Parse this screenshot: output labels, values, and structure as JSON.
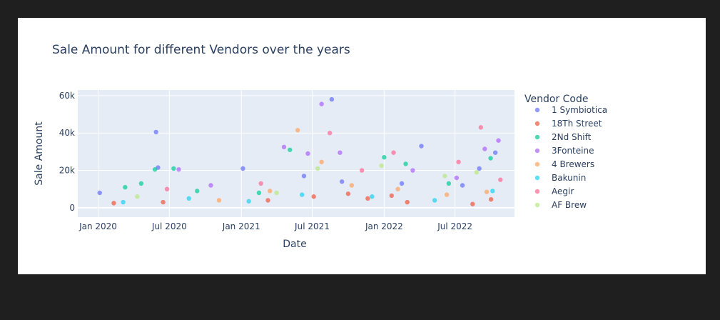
{
  "chart_data": {
    "type": "scatter",
    "title": "Sale Amount for different Vendors over the years",
    "xlabel": "Date",
    "ylabel": "Sale Amount",
    "x_ticks": [
      "Jan 2020",
      "Jul 2020",
      "Jan 2021",
      "Jul 2021",
      "Jan 2022",
      "Jul 2022"
    ],
    "x_tick_dates": [
      "2020-01-01",
      "2020-07-01",
      "2021-01-01",
      "2021-07-01",
      "2022-01-01",
      "2022-07-01"
    ],
    "y_ticks": [
      "0",
      "20k",
      "40k",
      "60k"
    ],
    "y_tick_values": [
      0,
      20000,
      40000,
      60000
    ],
    "xlim": [
      "2019-11-10",
      "2022-11-30"
    ],
    "ylim": [
      -5000,
      63000
    ],
    "grid": true,
    "legend_title": "Vendor Code",
    "legend_position": "right",
    "series": [
      {
        "name": "1 Symbiotica",
        "color": "#636efa",
        "points": [
          [
            "2020-05-28",
            40500
          ],
          [
            "2021-08-20",
            58000
          ],
          [
            "2020-06-02",
            21500
          ],
          [
            "2021-01-05",
            21000
          ],
          [
            "2022-04-06",
            33000
          ],
          [
            "2022-09-01",
            21000
          ],
          [
            "2022-10-12",
            29500
          ],
          [
            "2020-01-05",
            8000
          ],
          [
            "2021-06-10",
            17000
          ],
          [
            "2022-02-15",
            13000
          ],
          [
            "2021-09-15",
            14000
          ],
          [
            "2022-07-20",
            12000
          ]
        ]
      },
      {
        "name": "18Th Street",
        "color": "#EF553B",
        "points": [
          [
            "2020-02-10",
            2500
          ],
          [
            "2020-06-15",
            3000
          ],
          [
            "2021-03-10",
            4000
          ],
          [
            "2021-07-05",
            6000
          ],
          [
            "2021-11-20",
            5000
          ],
          [
            "2022-03-01",
            3000
          ],
          [
            "2022-08-15",
            2000
          ],
          [
            "2022-10-01",
            4500
          ],
          [
            "2021-10-01",
            7500
          ],
          [
            "2022-01-20",
            6500
          ]
        ]
      },
      {
        "name": "2Nd Shift",
        "color": "#00cc96",
        "points": [
          [
            "2020-05-25",
            20500
          ],
          [
            "2020-07-12",
            21000
          ],
          [
            "2020-04-20",
            13000
          ],
          [
            "2021-05-05",
            31000
          ],
          [
            "2022-01-01",
            27000
          ],
          [
            "2022-02-25",
            23500
          ],
          [
            "2022-09-30",
            26500
          ],
          [
            "2020-03-10",
            11000
          ],
          [
            "2020-09-10",
            9000
          ],
          [
            "2021-02-15",
            8000
          ],
          [
            "2022-06-15",
            13000
          ]
        ]
      },
      {
        "name": "3Fonteine",
        "color": "#ab63fa",
        "points": [
          [
            "2021-07-25",
            55500
          ],
          [
            "2021-04-20",
            32500
          ],
          [
            "2022-09-15",
            31500
          ],
          [
            "2020-07-25",
            20500
          ],
          [
            "2021-06-20",
            29000
          ],
          [
            "2022-03-15",
            20000
          ],
          [
            "2022-10-20",
            36000
          ],
          [
            "2021-09-10",
            29500
          ],
          [
            "2020-10-15",
            12000
          ],
          [
            "2022-07-05",
            16000
          ]
        ]
      },
      {
        "name": "4 Brewers",
        "color": "#FFA15A",
        "points": [
          [
            "2021-05-25",
            41500
          ],
          [
            "2021-07-25",
            24500
          ],
          [
            "2021-03-15",
            9000
          ],
          [
            "2021-10-10",
            12000
          ],
          [
            "2022-02-05",
            10000
          ],
          [
            "2020-11-05",
            4000
          ],
          [
            "2022-06-10",
            7000
          ],
          [
            "2022-09-20",
            8500
          ]
        ]
      },
      {
        "name": "Bakunin",
        "color": "#19d3f3",
        "points": [
          [
            "2020-03-05",
            3000
          ],
          [
            "2020-08-20",
            5000
          ],
          [
            "2021-01-20",
            3500
          ],
          [
            "2021-06-05",
            7000
          ],
          [
            "2021-12-01",
            6000
          ],
          [
            "2022-05-10",
            4000
          ],
          [
            "2022-10-05",
            9000
          ]
        ]
      },
      {
        "name": "Aegir",
        "color": "#FF6692",
        "points": [
          [
            "2021-08-15",
            40000
          ],
          [
            "2022-01-25",
            29500
          ],
          [
            "2022-09-05",
            43000
          ],
          [
            "2022-07-10",
            24500
          ],
          [
            "2021-02-20",
            13000
          ],
          [
            "2020-06-25",
            10000
          ],
          [
            "2021-11-05",
            20000
          ],
          [
            "2022-10-25",
            15000
          ]
        ]
      },
      {
        "name": "AF Brew",
        "color": "#B6E880",
        "points": [
          [
            "2021-12-25",
            22500
          ],
          [
            "2022-06-05",
            17000
          ],
          [
            "2021-07-15",
            21000
          ],
          [
            "2020-04-10",
            6000
          ],
          [
            "2022-08-25",
            19000
          ],
          [
            "2021-04-01",
            8000
          ]
        ]
      }
    ]
  }
}
